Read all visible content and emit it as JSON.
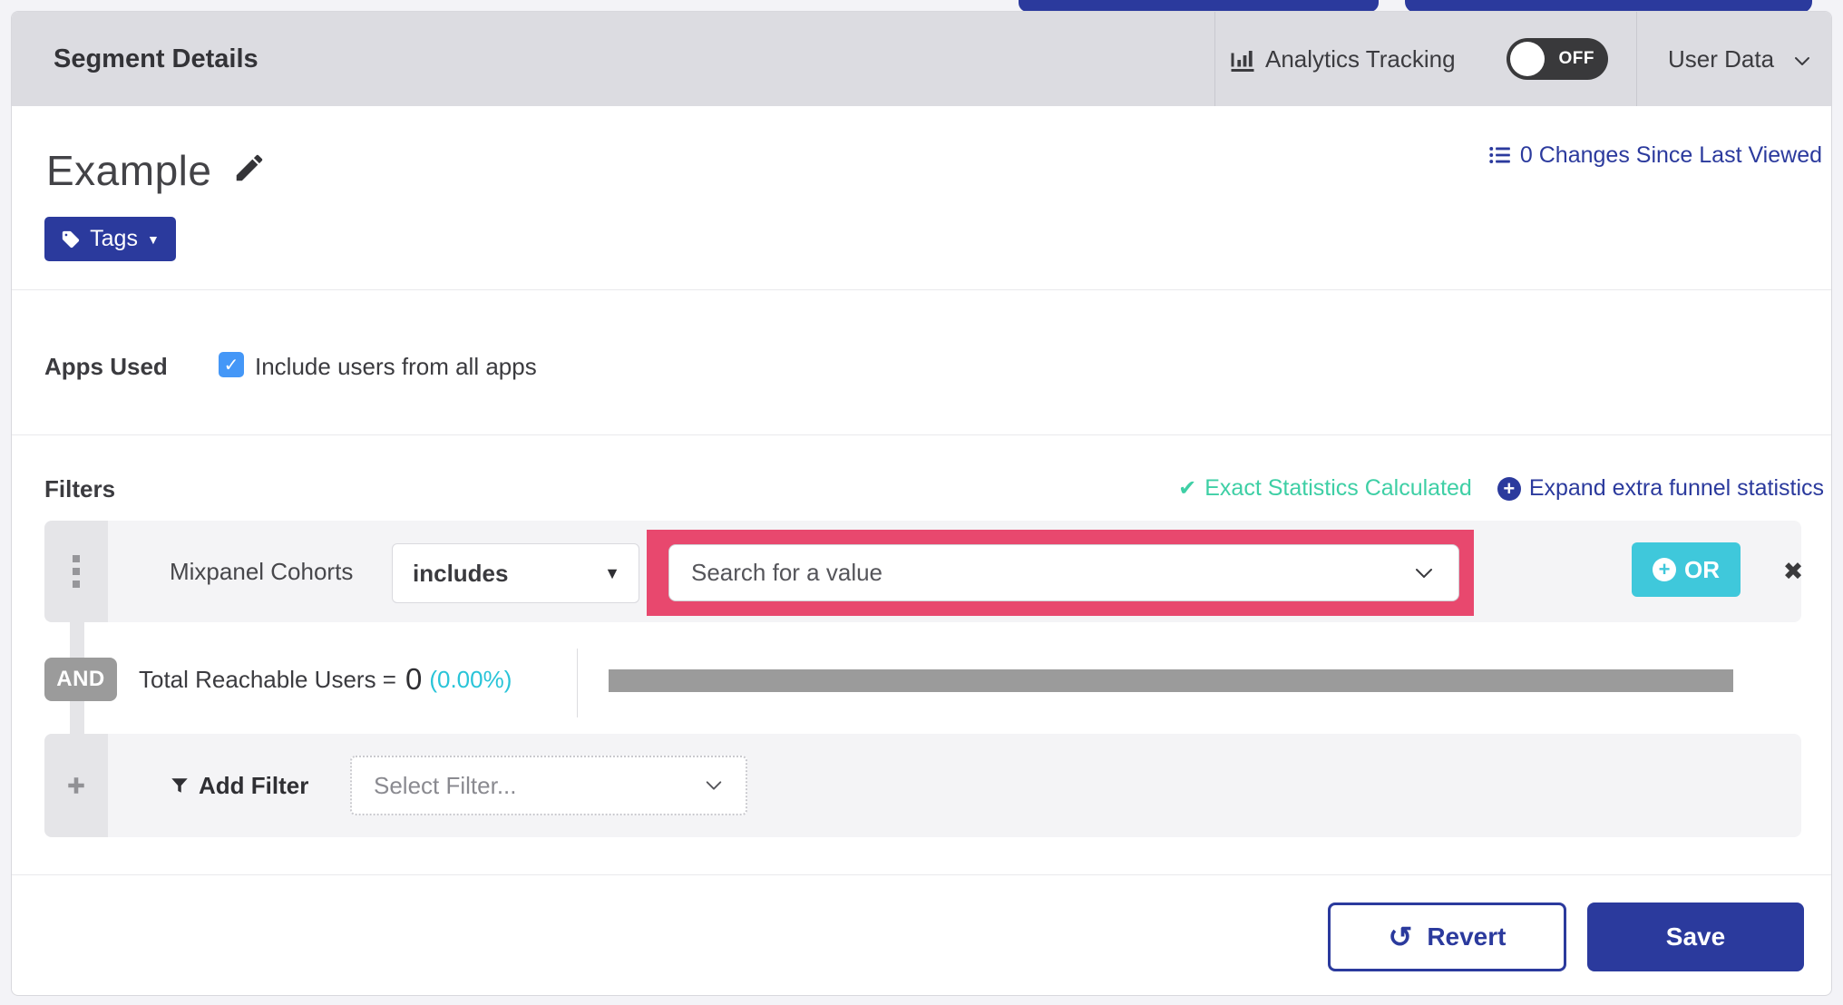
{
  "colors": {
    "navy": "#2b3a9d",
    "cyan_button": "#3fc8db",
    "teal_success": "#3ecfa5",
    "pink_highlight": "#e8486e",
    "percent_cyan": "#29c4d8",
    "bar_gray": "#9b9b9b",
    "checkbox_blue": "#4497f7",
    "header_gray": "#dcdce1",
    "toggle_dark": "#39393b"
  },
  "header": {
    "title": "Segment Details",
    "analytics_label": "Analytics Tracking",
    "toggle_state": "OFF",
    "user_data_label": "User Data"
  },
  "segment": {
    "name": "Example",
    "tags_button": "Tags",
    "changes_link": "0 Changes Since Last Viewed"
  },
  "apps_used": {
    "label": "Apps Used",
    "checkbox_label": "Include users from all apps",
    "checked": true
  },
  "filters": {
    "heading": "Filters",
    "exact_stats_label": "Exact Statistics Calculated",
    "expand_link_label": "Expand extra funnel statistics",
    "row": {
      "field": "Mixpanel Cohorts",
      "operator": "includes",
      "value_placeholder": "Search for a value",
      "or_button": "OR"
    },
    "connector": "AND",
    "reachable": {
      "label": "Total Reachable Users =",
      "value": "0",
      "percent": "(0.00%)"
    },
    "add_filter": {
      "label": "Add Filter",
      "placeholder": "Select Filter..."
    }
  },
  "footer": {
    "revert_label": "Revert",
    "save_label": "Save"
  },
  "icons": {
    "check": "✔",
    "checkbox_check": "✓",
    "caret_down": "▼",
    "close": "✖",
    "plus": "+",
    "revert": "↺"
  }
}
